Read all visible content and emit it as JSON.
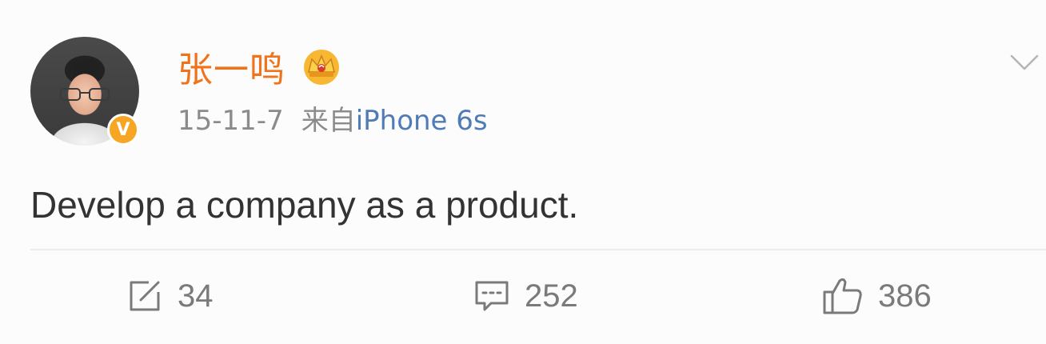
{
  "post": {
    "username": "张一鸣",
    "date": "15-11-7",
    "source_prefix": "来自",
    "source_device": "iPhone 6s",
    "text": "Develop a company as a product.",
    "verified_badge": "V",
    "icons": {
      "crown": "crown-icon",
      "menu": "chevron-down-icon",
      "repost": "repost-icon",
      "comment": "comment-icon",
      "like": "thumbs-up-icon"
    },
    "colors": {
      "username": "#f0731b",
      "device": "#4f7bb7",
      "badge": "#f6a623",
      "meta": "#8b8b8b"
    }
  },
  "actions": {
    "repost_count": "34",
    "comment_count": "252",
    "like_count": "386"
  }
}
